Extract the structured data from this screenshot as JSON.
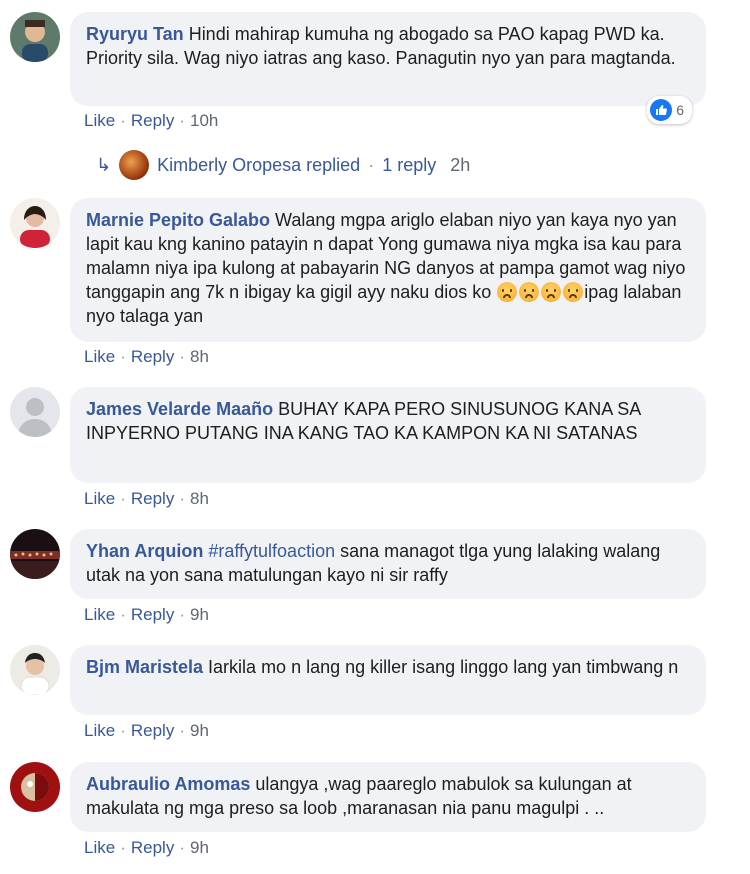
{
  "actions": {
    "like": "Like",
    "reply": "Reply",
    "sep": "·"
  },
  "comments": [
    {
      "author": "Ryuryu Tan",
      "text": " Hindi mahirap kumuha ng abogado sa PAO kapag PWD ka. Priority sila. Wag niyo iatras ang kaso. Panagutin nyo yan para magtanda.",
      "time": "10h",
      "reactions": "6",
      "avatar_color": "#6b5a4e"
    },
    {
      "author": "Marnie Pepito Galabo",
      "text": " Walang mgpa ariglo elaban niyo yan kaya nyo yan lapit kau kng kanino patayin n dapat Yong gumawa niya mgka isa kau para malamn niya ipa kulong at pabayarin NG danyos at pampa gamot wag niyo tanggapin ang 7k n ibigay ka gigil ayy naku dios ko",
      "text_after": "ipag lalaban nyo talaga yan",
      "time": "8h",
      "avatar_color": "#c93a4a"
    },
    {
      "author": "James Velarde Maaño",
      "text": " BUHAY KAPA PERO SINUSUNOG KANA SA INPYERNO PUTANG INA KANG TAO KA KAMPON KA NI SATANAS",
      "time": "8h",
      "avatar_color": "#c9ccd1"
    },
    {
      "author": "Yhan Arquion",
      "hashtag": "#raffytulfoaction",
      "text": " sana managot tlga yung lalaking walang utak na yon sana matulungan kayo ni sir raffy",
      "time": "9h",
      "avatar_color": "#3a2020"
    },
    {
      "author": "Bjm Maristela",
      "text": " Iarkila mo n lang ng killer isang linggo lang yan timbwang n",
      "time": "9h",
      "avatar_color": "#e8e4dc"
    },
    {
      "author": "Aubraulio Amomas",
      "text": " ulangya ,wag paareglo mabulok sa kulungan at makulata ng mga preso sa loob ,maranasan nia panu magulpi . ..",
      "time": "9h",
      "avatar_color": "#b81818"
    }
  ],
  "reply_thread": {
    "name": "Kimberly Oropesa",
    "label": " replied",
    "count": "1 reply",
    "time": "2h"
  }
}
